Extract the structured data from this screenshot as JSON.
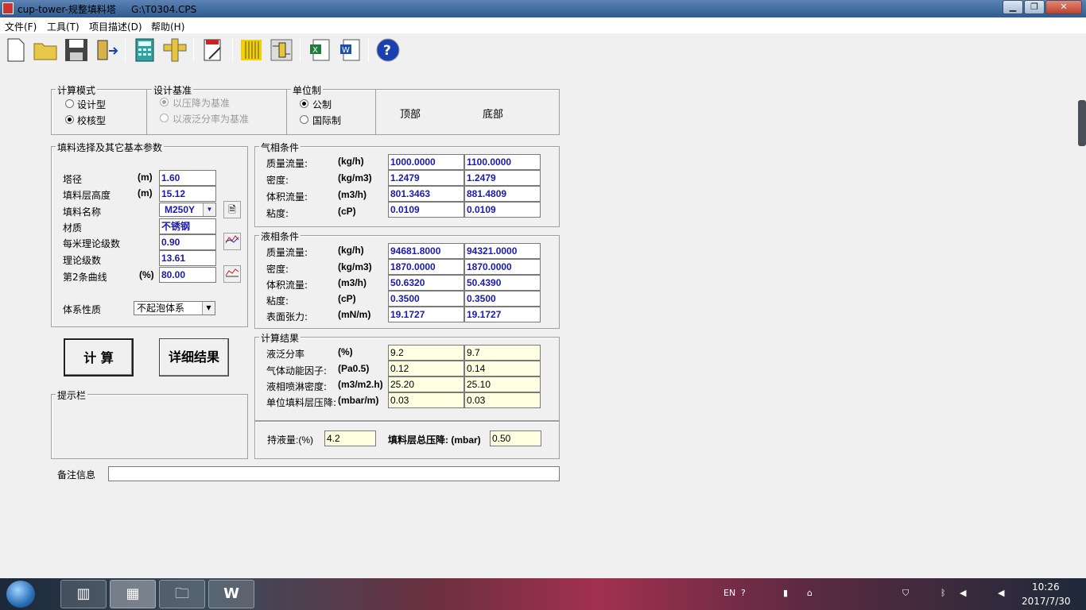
{
  "window": {
    "title": "cup-tower-规整填料塔     G:\\T0304.CPS",
    "min": "▁",
    "max": "❐",
    "close": "✕"
  },
  "menu": [
    "文件(F)",
    "工具(T)",
    "项目描述(D)",
    "帮助(H)"
  ],
  "calc_mode": {
    "legend": "计算模式",
    "options": [
      "设计型",
      "校核型"
    ],
    "selected": 1
  },
  "design_basis": {
    "legend": "设计基准",
    "options": [
      "以压降为基准",
      "以液泛分率为基准"
    ],
    "selected": 0
  },
  "unit_system": {
    "legend": "单位制",
    "options": [
      "公制",
      "国际制"
    ],
    "selected": 0
  },
  "col_headers": {
    "top": "顶部",
    "bottom": "底部"
  },
  "packing": {
    "legend": "填料选择及其它基本参数",
    "rows": [
      {
        "label": "塔径",
        "unit": "(m)",
        "value": "1.60"
      },
      {
        "label": "填料层高度",
        "unit": "(m)",
        "value": "15.12"
      },
      {
        "label": "填料名称",
        "unit": "",
        "value": "M250Y"
      },
      {
        "label": "材质",
        "unit": "",
        "value": "不锈钢"
      },
      {
        "label": "每米理论级数",
        "unit": "",
        "value": "0.90"
      },
      {
        "label": "理论级数",
        "unit": "",
        "value": "13.61"
      },
      {
        "label": "第2条曲线",
        "unit": "(%)",
        "value": "80.00"
      }
    ],
    "system_label": "体系性质",
    "system_value": "不起泡体系"
  },
  "gas": {
    "legend": "气相条件",
    "rows": [
      {
        "label": "质量流量:",
        "unit": "(kg/h)",
        "top": "1000.0000",
        "bottom": "1100.0000"
      },
      {
        "label": "密度:",
        "unit": "(kg/m3)",
        "top": "1.2479",
        "bottom": "1.2479"
      },
      {
        "label": "体积流量:",
        "unit": "(m3/h)",
        "top": "801.3463",
        "bottom": "881.4809"
      },
      {
        "label": "粘度:",
        "unit": "(cP)",
        "top": "0.0109",
        "bottom": "0.0109"
      }
    ]
  },
  "liquid": {
    "legend": "液相条件",
    "rows": [
      {
        "label": "质量流量:",
        "unit": "(kg/h)",
        "top": "94681.8000",
        "bottom": "94321.0000"
      },
      {
        "label": "密度:",
        "unit": "(kg/m3)",
        "top": "1870.0000",
        "bottom": "1870.0000"
      },
      {
        "label": "体积流量:",
        "unit": "(m3/h)",
        "top": "50.6320",
        "bottom": "50.4390"
      },
      {
        "label": "粘度:",
        "unit": "(cP)",
        "top": "0.3500",
        "bottom": "0.3500"
      },
      {
        "label": "表面张力:",
        "unit": "(mN/m)",
        "top": "19.1727",
        "bottom": "19.1727"
      }
    ]
  },
  "results": {
    "legend": "计算结果",
    "rows": [
      {
        "label": "液泛分率",
        "unit": "(%)",
        "top": "9.2",
        "bottom": "9.7"
      },
      {
        "label": "气体动能因子:",
        "unit": "(Pa0.5)",
        "top": "0.12",
        "bottom": "0.14"
      },
      {
        "label": "液相喷淋密度:",
        "unit": "(m3/m2.h)",
        "top": "25.20",
        "bottom": "25.10"
      },
      {
        "label": "单位填料层压降:",
        "unit": "(mbar/m)",
        "top": "0.03",
        "bottom": "0.03"
      }
    ]
  },
  "holdup": {
    "label": "持液量:(%)",
    "value": "4.2",
    "pd_label": "填料层总压降: (mbar)",
    "pd_value": "0.50"
  },
  "buttons": {
    "calc": "计  算",
    "detail": "详细结果"
  },
  "hint": {
    "legend": "提示栏"
  },
  "remark": {
    "label": "备注信息",
    "value": ""
  },
  "tray": {
    "lang": "EN",
    "time": "10:26",
    "date": "2017/7/30"
  }
}
